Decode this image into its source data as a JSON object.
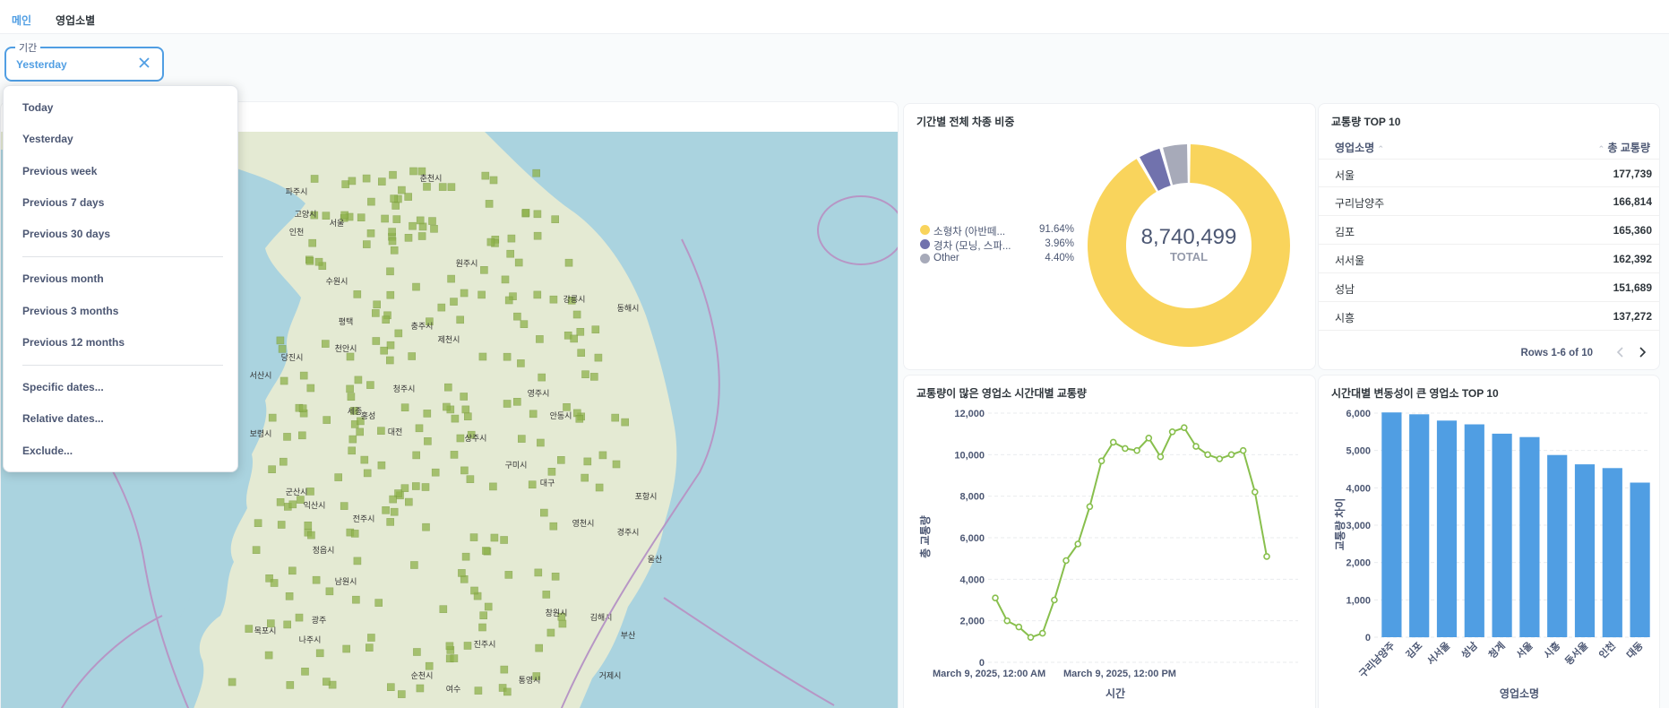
{
  "tabs": [
    {
      "label": "메인",
      "active": true
    },
    {
      "label": "영업소별",
      "active": false
    }
  ],
  "filter": {
    "legend": "기간",
    "value": "Yesterday"
  },
  "dropdown": {
    "groups": [
      [
        "Today",
        "Yesterday",
        "Previous week",
        "Previous 7 days",
        "Previous 30 days"
      ],
      [
        "Previous month",
        "Previous 3 months",
        "Previous 12 months"
      ],
      [
        "Specific dates...",
        "Relative dates...",
        "Exclude..."
      ]
    ]
  },
  "map": {
    "labels": [
      "파주시",
      "고양시",
      "서울",
      "인천",
      "수원시",
      "평택",
      "천안시",
      "당진시",
      "서산시",
      "홍성",
      "대전",
      "보령시",
      "세종",
      "전주시",
      "군산시",
      "익산시",
      "광주",
      "나주시",
      "목포시",
      "순천시",
      "여수",
      "진주시",
      "창원시",
      "김해시",
      "부산",
      "울산",
      "경주시",
      "포항시",
      "구미시",
      "대구",
      "안동시",
      "춘천시",
      "원주시",
      "강릉시",
      "동해시",
      "제천시",
      "충주시",
      "청주시",
      "상주시",
      "남원시",
      "정읍시",
      "거제시",
      "통영시",
      "영천시",
      "영주시"
    ]
  },
  "donut": {
    "title": "기간별 전체 차종 비중",
    "total": "8,740,499",
    "total_label": "TOTAL",
    "colors": [
      "#f9d45c",
      "#7172ad",
      "#a7aab9"
    ],
    "items": [
      {
        "name": "소형차 (아반떼...",
        "pct": "91.64%",
        "value": 91.64
      },
      {
        "name": "경차 (모닝, 스파...",
        "pct": "3.96%",
        "value": 3.96
      },
      {
        "name": "Other",
        "pct": "4.40%",
        "value": 4.4
      }
    ]
  },
  "table": {
    "title": "교통량 TOP 10",
    "col_name": "영업소명",
    "col_value": "총 교통량",
    "rows": [
      {
        "name": "서울",
        "value": "177,739"
      },
      {
        "name": "구리남양주",
        "value": "166,814"
      },
      {
        "name": "김포",
        "value": "165,360"
      },
      {
        "name": "서서울",
        "value": "162,392"
      },
      {
        "name": "성남",
        "value": "151,689"
      },
      {
        "name": "시흥",
        "value": "137,272"
      }
    ],
    "pager": "Rows 1-6 of 10"
  },
  "line_chart": {
    "title": "교통량이 많은 영업소 시간대별 교통량",
    "color": "#88bf4d"
  },
  "bar_chart": {
    "title": "시간대별 변동성이 큰 영업소 TOP 10",
    "color": "#509ee3"
  },
  "chart_data": [
    {
      "type": "line",
      "title": "교통량이 많은 영업소 시간대별 교통량",
      "xlabel": "시간",
      "ylabel": "총 교통량",
      "x_tick_labels": [
        "March 9, 2025, 12:00 AM",
        "March 9, 2025, 12:00 PM"
      ],
      "x": [
        0,
        1,
        2,
        3,
        4,
        5,
        6,
        7,
        8,
        9,
        10,
        11,
        12,
        13,
        14,
        15,
        16,
        17,
        18,
        19,
        20,
        21,
        22,
        23
      ],
      "values": [
        3100,
        2000,
        1700,
        1200,
        1400,
        3000,
        4900,
        5700,
        7500,
        9700,
        10600,
        10300,
        10200,
        10800,
        9900,
        11100,
        11300,
        10400,
        10000,
        9800,
        10000,
        10200,
        8200,
        5100
      ],
      "ylim": [
        0,
        12000
      ],
      "y_ticks": [
        "0",
        "2,000",
        "4,000",
        "6,000",
        "8,000",
        "10,000",
        "12,000"
      ]
    },
    {
      "type": "bar",
      "title": "시간대별 변동성이 큰 영업소 TOP 10",
      "xlabel": "영업소명",
      "ylabel": "교통량 차이",
      "categories": [
        "구리남양주",
        "김포",
        "서서울",
        "성남",
        "청계",
        "서울",
        "시흥",
        "동서울",
        "인천",
        "대동"
      ],
      "values": [
        6020,
        5970,
        5800,
        5700,
        5450,
        5360,
        4880,
        4630,
        4530,
        4140
      ],
      "ylim": [
        0,
        6000
      ],
      "y_ticks": [
        "0",
        "1,000",
        "2,000",
        "3,000",
        "4,000",
        "5,000",
        "6,000"
      ]
    }
  ]
}
